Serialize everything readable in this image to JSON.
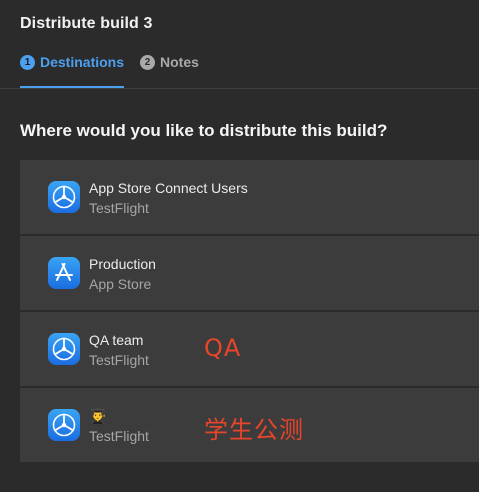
{
  "dialog": {
    "title": "Distribute build 3"
  },
  "tabs": [
    {
      "number": "1",
      "label": "Destinations",
      "active": true
    },
    {
      "number": "2",
      "label": "Notes",
      "active": false
    }
  ],
  "question": "Where would you like to distribute this build?",
  "destinations": [
    {
      "name": "App Store Connect Users",
      "type": "TestFlight",
      "icon": "testflight-icon",
      "annotation": ""
    },
    {
      "name": "Production",
      "type": "App Store",
      "icon": "app-store-icon",
      "annotation": ""
    },
    {
      "name": "QA team",
      "type": "TestFlight",
      "icon": "testflight-icon",
      "annotation": "QA"
    },
    {
      "name": "👨‍🎓",
      "type": "TestFlight",
      "icon": "testflight-icon",
      "annotation": "学生公测"
    }
  ],
  "colors": {
    "accent": "#4ca0f0",
    "annotation": "#e8452a",
    "background": "#2b2b2b",
    "row_background": "#3c3c3c"
  }
}
